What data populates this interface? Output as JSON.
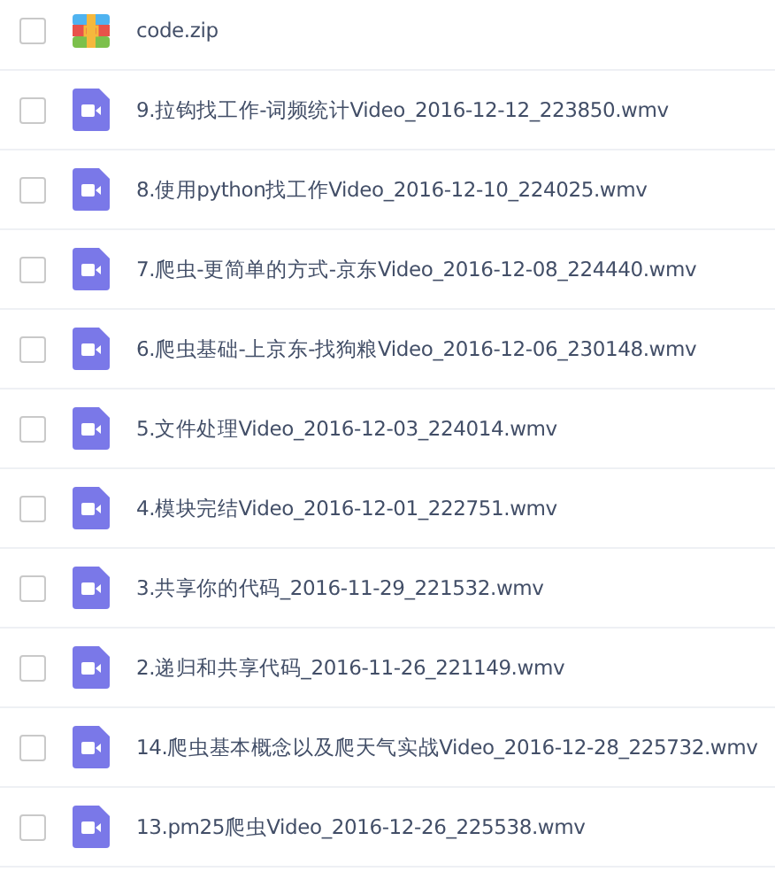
{
  "files": [
    {
      "kind": "zip",
      "name": "code.zip",
      "checked": false
    },
    {
      "kind": "video",
      "name": "9.拉钩找工作-词频统计Video_2016-12-12_223850.wmv",
      "checked": false
    },
    {
      "kind": "video",
      "name": "8.使用python找工作Video_2016-12-10_224025.wmv",
      "checked": false
    },
    {
      "kind": "video",
      "name": "7.爬虫-更简单的方式-京东Video_2016-12-08_224440.wmv",
      "checked": false
    },
    {
      "kind": "video",
      "name": "6.爬虫基础-上京东-找狗粮Video_2016-12-06_230148.wmv",
      "checked": false
    },
    {
      "kind": "video",
      "name": "5.文件处理Video_2016-12-03_224014.wmv",
      "checked": false
    },
    {
      "kind": "video",
      "name": "4.模块完结Video_2016-12-01_222751.wmv",
      "checked": false
    },
    {
      "kind": "video",
      "name": "3.共享你的代码_2016-11-29_221532.wmv",
      "checked": false
    },
    {
      "kind": "video",
      "name": "2.递归和共享代码_2016-11-26_221149.wmv",
      "checked": false
    },
    {
      "kind": "video",
      "name": "14.爬虫基本概念以及爬天气实战Video_2016-12-28_225732.wmv",
      "checked": false
    },
    {
      "kind": "video",
      "name": "13.pm25爬虫Video_2016-12-26_225538.wmv",
      "checked": false
    }
  ]
}
